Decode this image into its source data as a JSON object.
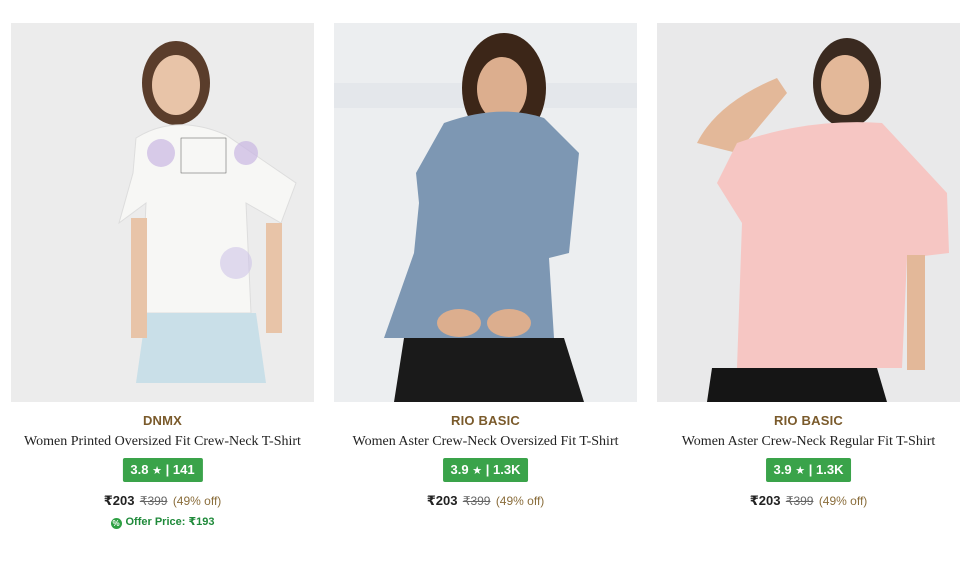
{
  "products": [
    {
      "brand": "DNMX",
      "name": "Women Printed Oversized Fit Crew-Neck T-Shirt",
      "rating": "3.8",
      "rating_count": "141",
      "price": "₹203",
      "mrp": "₹399",
      "discount": "(49% off)",
      "offer_text": "Offer Price: ₹193",
      "shirt_color": "#f7f7f5",
      "bg_color": "#ececec"
    },
    {
      "brand": "RIO BASIC",
      "name": "Women Aster Crew-Neck Oversized Fit T-Shirt",
      "rating": "3.9",
      "rating_count": "1.3K",
      "price": "₹203",
      "mrp": "₹399",
      "discount": "(49% off)",
      "shirt_color": "#7d97b3",
      "bg_color": "#eceef0"
    },
    {
      "brand": "RIO BASIC",
      "name": "Women Aster Crew-Neck Regular Fit T-Shirt",
      "rating": "3.9",
      "rating_count": "1.3K",
      "price": "₹203",
      "mrp": "₹399",
      "discount": "(49% off)",
      "shirt_color": "#f6c6c3",
      "bg_color": "#e9e9ea"
    }
  ],
  "labels": {
    "rating_separator": "|",
    "star": "★"
  }
}
